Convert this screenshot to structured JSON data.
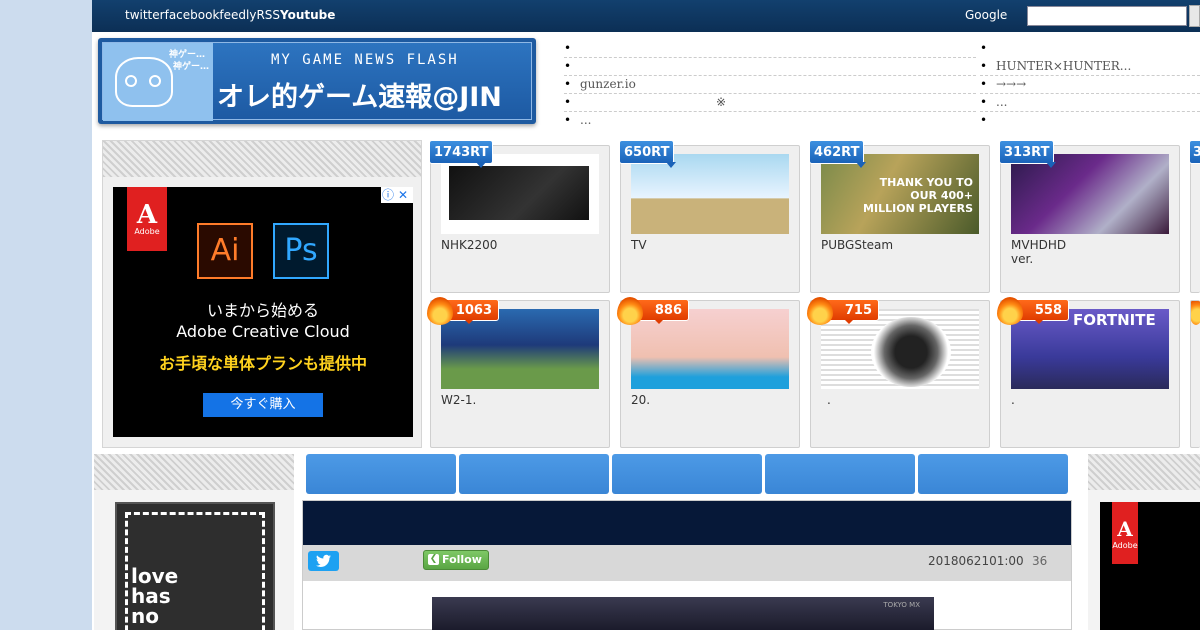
{
  "topbar": {
    "nav": [
      "twitter",
      "facebook",
      "feedly",
      "RSS",
      "Youtube"
    ],
    "google_label": "Google",
    "search_placeholder": ""
  },
  "logo": {
    "kami_text_1": "神ゲー…",
    "kami_text_2": "神ゲー…",
    "subtitle": "MY GAME NEWS FLASH",
    "title": "オレ的ゲーム速報@JIN"
  },
  "header_news_left": [
    "",
    "",
    "gunzer.io",
    "※",
    "..."
  ],
  "header_news_right": [
    "",
    "HUNTER×HUNTER...",
    "→→→",
    "...",
    ""
  ],
  "left_ad": {
    "adchoices": "ⓘ✕",
    "brand": "Adobe",
    "app1": "Ai",
    "app2": "Ps",
    "line1": "いまから始める",
    "line2": "Adobe Creative Cloud",
    "line3": "お手頃な単体プランも提供中",
    "button": "今すぐ購入"
  },
  "rt_cards": [
    {
      "rt": "1743RT",
      "title": "NHK2200"
    },
    {
      "rt": "650RT",
      "title": "TV"
    },
    {
      "rt": "462RT",
      "title": "PUBGSteam",
      "thumb_text": "THANK YOU TO OUR 400+ MILLION PLAYERS"
    },
    {
      "rt": "313RT",
      "title": "MVHDHD ver."
    },
    {
      "rt": "3"
    }
  ],
  "hot_cards": [
    {
      "count": "1063",
      "title": "W2-1."
    },
    {
      "count": "886",
      "title": "20."
    },
    {
      "count": "715",
      "title": "."
    },
    {
      "count": "558",
      "title": ".",
      "thumb_text": "FORTNITE"
    }
  ],
  "poster_text": "love has no",
  "article": {
    "follow_label": "Follow",
    "date": "2018062101:00",
    "count": "36",
    "image_watermark": "TOKYO MX"
  },
  "right_ad": {
    "brand": "Adobe"
  },
  "colors": {
    "topbar": "#12406e",
    "tab": "#4d9ae6",
    "rt_badge": "#1a62b8",
    "hot_badge": "#e03c00",
    "background": "#ccdcee"
  }
}
